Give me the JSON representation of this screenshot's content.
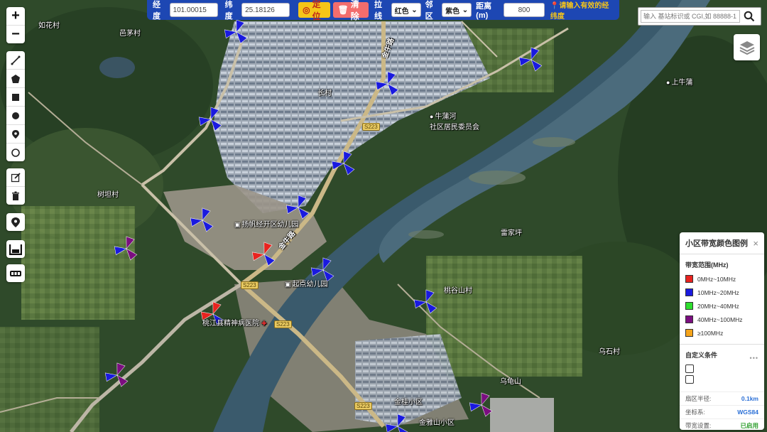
{
  "toolbar": {
    "lng_label": "经度",
    "lng_value": "101.00015",
    "lat_label": "纬度",
    "lat_value": "25.18126",
    "locate_label": "定位",
    "clear_label": "清除",
    "line_label": "拉线",
    "line_color": "红色",
    "neighbor_label": "邻区",
    "neighbor_color": "紫色",
    "distance_label": "距离(m)",
    "distance_value": "800",
    "hint": "请输入有效的经纬度"
  },
  "search": {
    "placeholder": "输入 基站标识或 CGI,如 88888-1"
  },
  "left_tools": {
    "zoom": [
      "zoom-in",
      "zoom-out"
    ],
    "draw": [
      "polyline",
      "polygon",
      "rectangle",
      "circle-filled",
      "marker",
      "circle"
    ],
    "edit": [
      "edit",
      "delete"
    ],
    "single": [
      "location-pin"
    ],
    "extra": [
      "fullscreen",
      "ruler"
    ]
  },
  "map_labels": {
    "village_ruhuacun": "如花村",
    "village_yimaocun": "邑茅村",
    "village_changcun": "长村",
    "road_jinniulu_1": "金牛路",
    "road_jinniulu_2": "金牛路",
    "niupuhe_line1": "牛蒲河",
    "niupuhe_line2": "社区居民委员会",
    "shuguzhuang": "上牛蒲",
    "shujicun": "树坦村",
    "kindergarten_1": "扬帆经开区幼儿园",
    "kindergarten_2": "起点幼儿园",
    "yunhanping": "雷家坪",
    "taoshancun": "桃谷山村",
    "hospital": "桃江县精神病医院",
    "wushicun": "乌石村",
    "wuguishan": "乌龟山",
    "xiaoqu_1": "金桂小区",
    "xiaoqu_2": "金雅山小区",
    "s223_1": "S223",
    "s223_2": "S223",
    "s223_3": "S223",
    "s223_4": "S223"
  },
  "legend": {
    "title": "小区带宽颜色图例",
    "close": "×",
    "range_title": "带宽范围(MHz)",
    "ranges": [
      {
        "label": "0MHz~10MHz",
        "color": "#e8231f"
      },
      {
        "label": "10MHz~20MHz",
        "color": "#1a1adf"
      },
      {
        "label": "20MHz~40MHz",
        "color": "#2ede2e"
      },
      {
        "label": "40MHz~100MHz",
        "color": "#7b0e80"
      },
      {
        "label": "≥100MHz",
        "color": "#f5a41b"
      }
    ],
    "custom_title": "自定义条件",
    "more": "•••",
    "radius_label": "扇区半径:",
    "radius_value": "0.1km",
    "coord_label": "坐标系:",
    "coord_value": "WGS84",
    "bw_label": "带宽设置:",
    "bw_value": "已启用"
  }
}
